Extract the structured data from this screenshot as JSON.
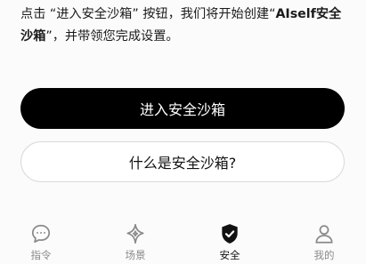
{
  "intro": {
    "part1": "点击 “进入安全沙箱” 按钮，我们将开始创建“",
    "brand": "AIself安全沙箱",
    "part2": "”，并带领您完成设置。"
  },
  "buttons": {
    "primary_label": "进入安全沙箱",
    "secondary_label": "什么是安全沙箱?"
  },
  "nav": {
    "active": "安全",
    "items": [
      {
        "label": "指令",
        "icon": "chat-bubble-icon"
      },
      {
        "label": "场景",
        "icon": "sparkle-icon"
      },
      {
        "label": "安全",
        "icon": "shield-check-icon"
      },
      {
        "label": "我的",
        "icon": "user-icon"
      }
    ]
  }
}
